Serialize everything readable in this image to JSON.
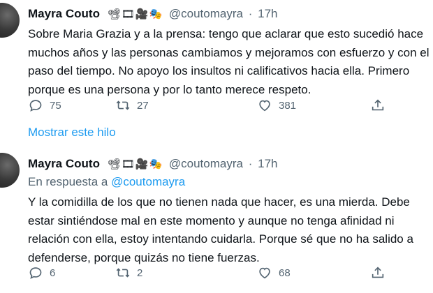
{
  "tweets": [
    {
      "name": "Mayra Couto",
      "emojis": "📽🎞🎥🎭",
      "handle": "@coutomayra",
      "separator": "·",
      "time": "17h",
      "text_lines": [
        "Sobre Maria Grazia y a la prensa: tengo que aclarar que esto sucedió hace",
        "muchos años y las personas cambiamos y mejoramos con esfuerzo y con el",
        "paso del tiempo. No apoyo los insultos ni calificativos hacia ella. Primero",
        "porque es una persona y por lo tanto merece respeto."
      ],
      "replies": "75",
      "retweets": "27",
      "likes": "381",
      "show_thread": "Mostrar este hilo"
    },
    {
      "name": "Mayra Couto",
      "emojis": "📽🎞🎥🎭",
      "handle": "@coutomayra",
      "separator": "·",
      "time": "17h",
      "reply_prefix": "En respuesta a",
      "reply_to": "@coutomayra",
      "text_lines": [
        "Y la comidilla de los que no tienen nada que hacer, es una mierda. Debe",
        "estar sintiéndose mal en este momento y aunque no tenga afinidad ni",
        "relación con ella, estoy intentando cuidarla. Porque sé que no ha salido a",
        "defenderse, porque quizás no tiene fuerzas."
      ],
      "replies": "6",
      "retweets": "2",
      "likes": "68"
    }
  ]
}
